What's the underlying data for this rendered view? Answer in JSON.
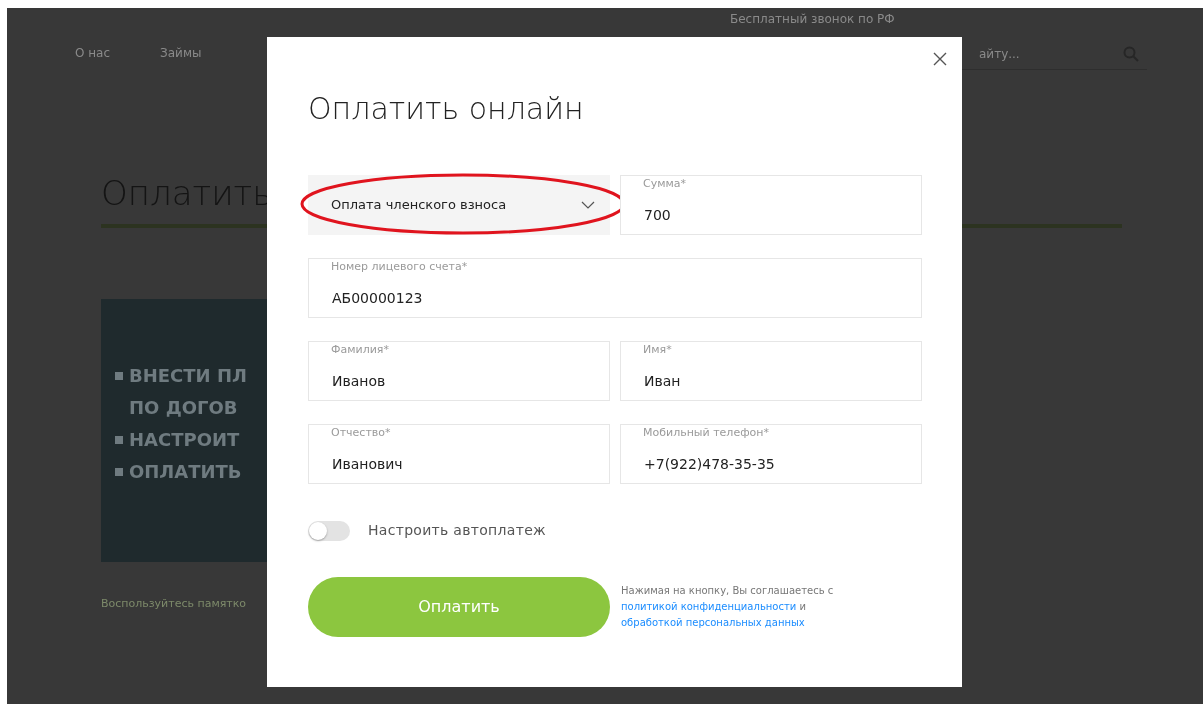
{
  "background_page": {
    "phone_caption": "Бесплатный звонок по РФ",
    "nav": [
      {
        "label": "О нас"
      },
      {
        "label": "Займы"
      }
    ],
    "search": {
      "placeholder": "айту..."
    },
    "heading": "Оплатить",
    "banner": {
      "lines": [
        {
          "text": "ВНЕСТИ ПЛ",
          "bullet": true
        },
        {
          "text": "ПО ДОГОВ",
          "bullet": false
        },
        {
          "text": "НАСТРОИТ",
          "bullet": true
        },
        {
          "text": "ОПЛАТИТЬ",
          "bullet": true
        }
      ]
    },
    "note": "Воспользуйтесь памятко"
  },
  "modal": {
    "title": "Оплатить онлайн",
    "rows": [
      [
        {
          "kind": "select",
          "value": "Оплата членского взноса",
          "highlighted": true
        },
        {
          "kind": "input",
          "label": "Сумма*",
          "value": "700"
        }
      ],
      [
        {
          "kind": "input",
          "label": "Номер лицевого счета*",
          "value": "АБ00000123"
        }
      ],
      [
        {
          "kind": "input",
          "label": "Фамилия*",
          "value": "Иванов"
        },
        {
          "kind": "input",
          "label": "Имя*",
          "value": "Иван"
        }
      ],
      [
        {
          "kind": "input",
          "label": "Отчество*",
          "value": "Иванович"
        },
        {
          "kind": "input",
          "label": "Мобильный телефон*",
          "value": "+7(922)478-35-35"
        }
      ]
    ],
    "autopay": {
      "label": "Настроить автоплатеж",
      "on": false
    },
    "pay_button": "Оплатить",
    "consent": {
      "text": "Нажимая на кнопку, Вы соглашаетесь с",
      "link_1": "политикой конфиденциальности",
      "joiner": "и",
      "link_2": "обработкой персональных данных"
    }
  }
}
